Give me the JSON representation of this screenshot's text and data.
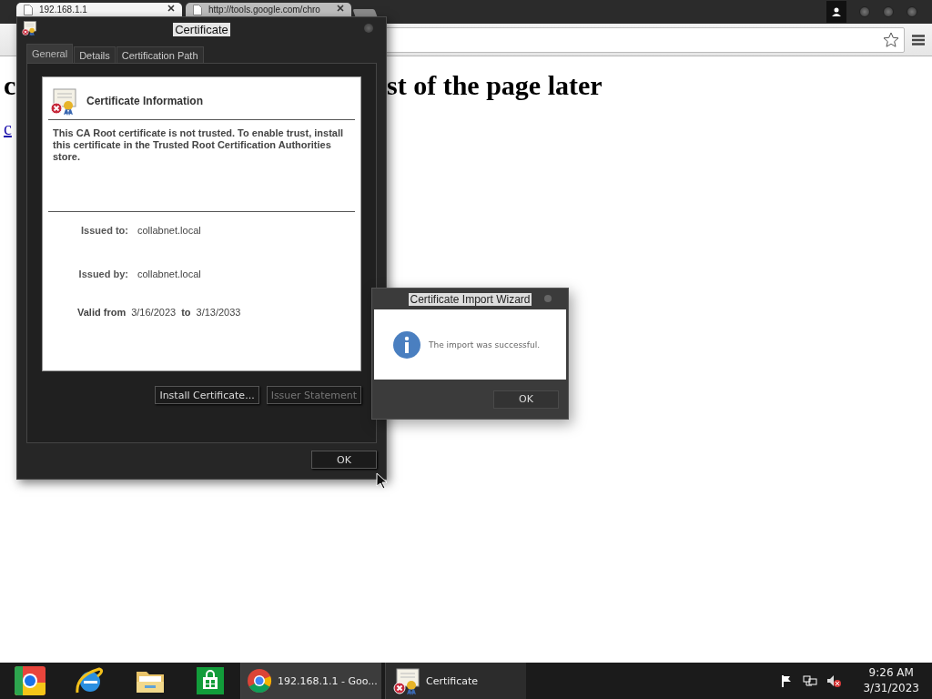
{
  "browser": {
    "tabs": [
      {
        "title": "192.168.1.1",
        "selected": true
      },
      {
        "title": "http://tools.google.com/chro",
        "selected": false
      }
    ]
  },
  "page": {
    "heading_fragments": [
      "c",
      "st of the page later"
    ],
    "link_fragment": "c"
  },
  "certificate_dialog": {
    "title": "Certificate",
    "tabs": [
      {
        "label": "General",
        "selected": true
      },
      {
        "label": "Details",
        "selected": false
      },
      {
        "label": "Certification Path",
        "selected": false
      }
    ],
    "info_title": "Certificate Information",
    "message": "This CA Root certificate is not trusted. To enable trust, install this certificate in the Trusted Root Certification Authorities store.",
    "fields": [
      {
        "label": "Issued to:",
        "value": "collabnet.local"
      },
      {
        "label": "Issued by:",
        "value": "collabnet.local"
      }
    ],
    "validity": {
      "label": "Valid from",
      "from": "3/16/2023",
      "to_label": "to",
      "to": "3/13/2033"
    },
    "buttons": [
      {
        "label": "Install Certificate...",
        "disabled": false
      },
      {
        "label": "Issuer Statement",
        "disabled": true
      }
    ],
    "ok": "OK"
  },
  "import_wizard": {
    "title": "Certificate Import Wizard",
    "message": "The import was successful.",
    "ok": "OK"
  },
  "taskbar": {
    "tasks": [
      {
        "label": "192.168.1.1 - Goo...",
        "kind": "browser",
        "selected": true
      },
      {
        "label": "Certificate",
        "kind": "certificate",
        "selected": false
      }
    ],
    "clock": {
      "time": "9:26 AM",
      "date": "3/31/2023"
    }
  }
}
